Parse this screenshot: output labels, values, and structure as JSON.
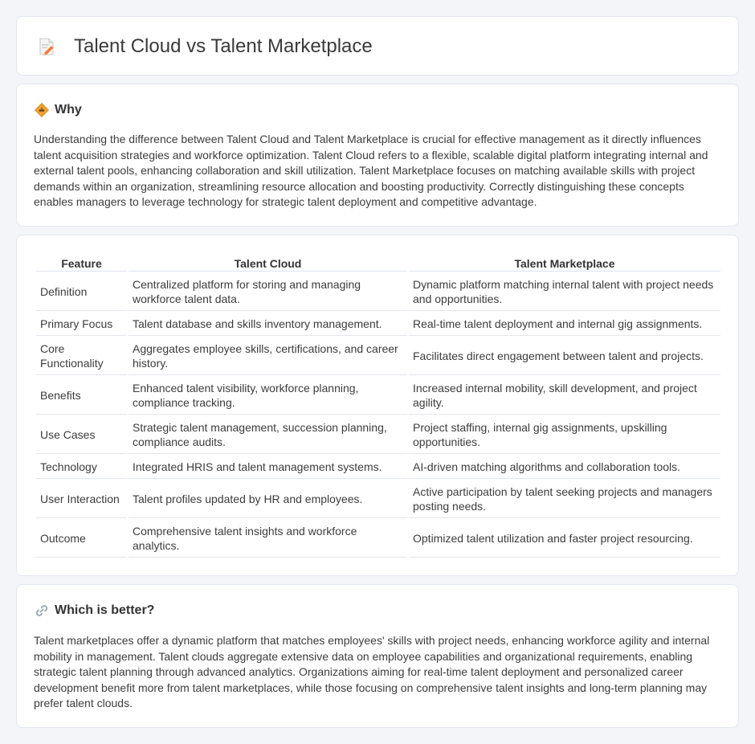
{
  "header": {
    "title": "Talent Cloud vs Talent Marketplace",
    "icon": "document-edit-icon"
  },
  "why": {
    "heading": "Why",
    "icon": "diamond-sign-icon",
    "text": "Understanding the difference between Talent Cloud and Talent Marketplace is crucial for effective management as it directly influences talent acquisition strategies and workforce optimization. Talent Cloud refers to a flexible, scalable digital platform integrating internal and external talent pools, enhancing collaboration and skill utilization. Talent Marketplace focuses on matching available skills with project demands within an organization, streamlining resource allocation and boosting productivity. Correctly distinguishing these concepts enables managers to leverage technology for strategic talent deployment and competitive advantage."
  },
  "table": {
    "headers": [
      "Feature",
      "Talent Cloud",
      "Talent Marketplace"
    ],
    "rows": [
      [
        "Definition",
        "Centralized platform for storing and managing workforce talent data.",
        "Dynamic platform matching internal talent with project needs and opportunities."
      ],
      [
        "Primary Focus",
        "Talent database and skills inventory management.",
        "Real-time talent deployment and internal gig assignments."
      ],
      [
        "Core Functionality",
        "Aggregates employee skills, certifications, and career history.",
        "Facilitates direct engagement between talent and projects."
      ],
      [
        "Benefits",
        "Enhanced talent visibility, workforce planning, compliance tracking.",
        "Increased internal mobility, skill development, and project agility."
      ],
      [
        "Use Cases",
        "Strategic talent management, succession planning, compliance audits.",
        "Project staffing, internal gig assignments, upskilling opportunities."
      ],
      [
        "Technology",
        "Integrated HRIS and talent management systems.",
        "AI-driven matching algorithms and collaboration tools."
      ],
      [
        "User Interaction",
        "Talent profiles updated by HR and employees.",
        "Active participation by talent seeking projects and managers posting needs."
      ],
      [
        "Outcome",
        "Comprehensive talent insights and workforce analytics.",
        "Optimized talent utilization and faster project resourcing."
      ]
    ]
  },
  "better": {
    "heading": "Which is better?",
    "icon": "link-icon",
    "text": "Talent marketplaces offer a dynamic platform that matches employees' skills with project needs, enhancing workforce agility and internal mobility in management. Talent clouds aggregate extensive data on employee capabilities and organizational requirements, enabling strategic talent planning through advanced analytics. Organizations aiming for real-time talent deployment and personalized career development benefit more from talent marketplaces, while those focusing on comprehensive talent insights and long-term planning may prefer talent clouds."
  },
  "colors": {
    "background": "#f3f5f9",
    "card": "#ffffff",
    "border": "#e2e6ee",
    "icon_orange": "#f0a030"
  }
}
